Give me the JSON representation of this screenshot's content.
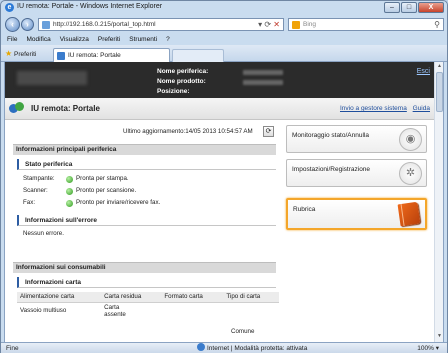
{
  "window": {
    "title": "IU remota: Portale - Windows Internet Explorer",
    "buttons": {
      "minimize": "–",
      "maximize": "□",
      "close": "X"
    }
  },
  "addressbar": {
    "url": "http://192.168.0.215/portal_top.html",
    "search_placeholder": "Bing"
  },
  "menu": [
    "File",
    "Modifica",
    "Visualizza",
    "Preferiti",
    "Strumenti",
    "?"
  ],
  "favorites": {
    "label": "Preferiti",
    "tab_label": "IU remota: Portale"
  },
  "device_header": {
    "labels": [
      "Nome periferica:",
      "Nome prodotto:",
      "Posizione:"
    ],
    "logout": "Esci"
  },
  "portal": {
    "title": "IU remota: Portale",
    "links": [
      "Invio a gestore sistema",
      "Guida"
    ]
  },
  "last_update": "Ultimo aggiornamento:14/05 2013 10:54:57 AM",
  "main_info": {
    "heading": "Informazioni principali periferica",
    "status_heading": "Stato periferica",
    "rows": [
      {
        "label": "Stampante:",
        "value": "Pronta per stampa."
      },
      {
        "label": "Scanner:",
        "value": "Pronto per scansione."
      },
      {
        "label": "Fax:",
        "value": "Pronto per inviare/ricevere fax."
      }
    ],
    "error_heading": "Informazioni sull'errore",
    "error_text": "Nessun errore."
  },
  "consumables": {
    "heading": "Informazioni sui consumabili",
    "paper_heading": "Informazioni carta",
    "columns": [
      "Alimentazione carta",
      "Carta residua",
      "Formato carta",
      "Tipo di carta"
    ],
    "rows": [
      {
        "source": "Vassoio multiuso",
        "remaining_1": "Carta",
        "remaining_2": "assente",
        "size": "",
        "type": ""
      }
    ],
    "footer_value": "Comune"
  },
  "side_menu": [
    {
      "label": "Monitoraggio stato/Annulla",
      "icon": "eye-icon"
    },
    {
      "label": "Impostazioni/Registrazione",
      "icon": "gear-icon"
    },
    {
      "label": "Rubrica",
      "icon": "address-book-icon"
    }
  ],
  "statusbar": {
    "left": "Fine",
    "zone": "Internet | Modalità protetta: attivata",
    "zoom": "100%"
  }
}
